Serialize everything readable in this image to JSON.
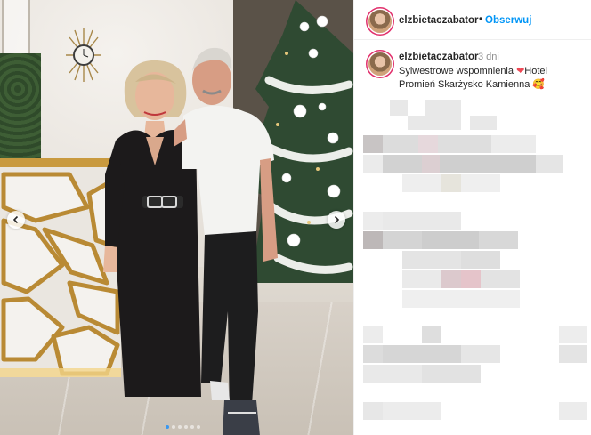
{
  "post": {
    "username": "elzbietaczabator",
    "separator": "•",
    "follow_label": "Obserwuj",
    "more_icon": "more-options-icon",
    "caption": {
      "username": "elzbietaczabator",
      "time": "3 dni",
      "text_part1": "Sylwestrowe wspomnienia ",
      "heart": "❤",
      "text_part2": "Hotel Promień Skarżysko Kamienna ",
      "smile": "🥰"
    }
  },
  "carousel": {
    "prev_icon": "chevron-left-icon",
    "next_icon": "chevron-right-icon",
    "dot_count": 6,
    "active_dot": 0
  },
  "colors": {
    "follow": "#0095f6",
    "username": "#262626",
    "muted": "#8e8e8e",
    "heart": "#ed4956",
    "active_dot": "#3897f0"
  }
}
